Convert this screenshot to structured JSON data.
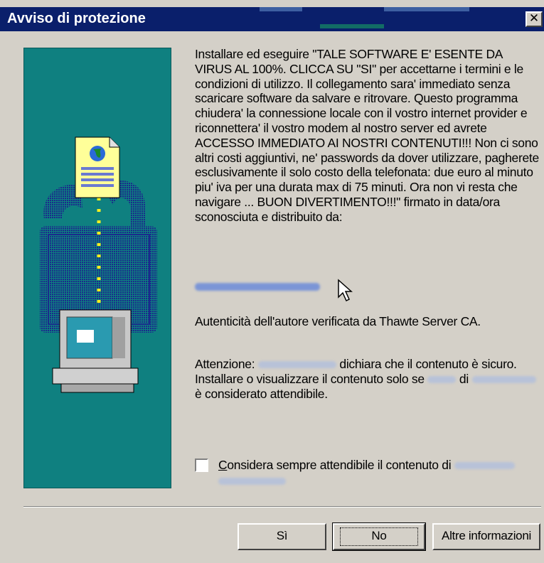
{
  "dialog": {
    "title": "Avviso di protezione",
    "close_symbol": "✕"
  },
  "message": {
    "body": "Installare ed eseguire \"TALE SOFTWARE E' ESENTE DA VIRUS AL 100%. CLICCA SU \"SI\" per accettarne i termini e le condizioni di utilizzo. Il collegamento sara' immediato senza scaricare software da salvare e ritrovare. Questo programma chiudera' la connessione locale con il vostro internet provider e riconnettera' il vostro modem al nostro server ed avrete ACCESSO IMMEDIATO AI NOSTRI CONTENUTI!!! Non ci sono altri costi aggiuntivi, ne' passwords da dover utilizzare, pagherete esclusivamente il solo costo della telefonata: due euro al minuto piu' iva per una durata max di 75 minuti. Ora non vi resta che navigare ... BUON DIVERTIMENTO!!!\" firmato in data/ora sconosciuta e distribuito da:"
  },
  "authenticity": "Autenticità dell'autore verificata da Thawte Server CA.",
  "warning": {
    "prefix": "Attenzione:",
    "middle": "dichiara che il contenuto è sicuro. Installare o visualizzare il contenuto solo se",
    "di": "di",
    "suffix": "è considerato attendibile."
  },
  "checkbox": {
    "label": "Considera sempre attendibile il contenuto di",
    "checked": false
  },
  "buttons": {
    "yes": "Sì",
    "no": "No",
    "more_info": "Altre informazioni"
  },
  "colors": {
    "titlebar": "#0a1f6b",
    "panel": "#0f8080",
    "dialog_bg": "#d4d0c8"
  },
  "icons": [
    "document-globe-icon",
    "padlock-icon",
    "computer-icon",
    "mouse-cursor-icon",
    "close-icon"
  ]
}
